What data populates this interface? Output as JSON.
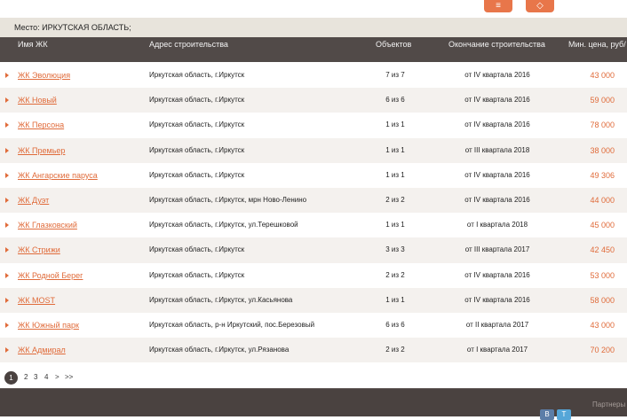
{
  "top_buttons": {
    "menu_icon": "≡",
    "pin_icon": "◇"
  },
  "location": "Место: ИРКУТСКАЯ ОБЛАСТЬ;",
  "columns": {
    "name": "Имя ЖК",
    "address": "Адрес строительства",
    "objects": "Объектов",
    "completion": "Окончание строительства",
    "min_price": "Мин. цена, руб/"
  },
  "rows": [
    {
      "name": "ЖК Эволюция",
      "address": "Иркутская область, г.Иркутск",
      "objects": "7 из 7",
      "completion": "от IV квартала 2016",
      "price": "43 000"
    },
    {
      "name": "ЖК Новый",
      "address": "Иркутская область, г.Иркутск",
      "objects": "6 из 6",
      "completion": "от IV квартала 2016",
      "price": "59 000"
    },
    {
      "name": "ЖК Персона",
      "address": "Иркутская область, г.Иркутск",
      "objects": "1 из 1",
      "completion": "от IV квартала 2016",
      "price": "78 000"
    },
    {
      "name": "ЖК Премьер",
      "address": "Иркутская область, г.Иркутск",
      "objects": "1 из 1",
      "completion": "от III квартала 2018",
      "price": "38 000"
    },
    {
      "name": "ЖК Ангарские паруса",
      "address": "Иркутская область, г.Иркутск",
      "objects": "1 из 1",
      "completion": "от IV квартала 2016",
      "price": "49 306"
    },
    {
      "name": "ЖК Дуэт",
      "address": "Иркутская область, г.Иркутск, мрн Ново-Ленино",
      "objects": "2 из 2",
      "completion": "от IV квартала 2016",
      "price": "44 000"
    },
    {
      "name": "ЖК Глазковский",
      "address": "Иркутская область, г.Иркутск, ул.Терешковой",
      "objects": "1 из 1",
      "completion": "от I квартала 2018",
      "price": "45 000"
    },
    {
      "name": "ЖК Стрижи",
      "address": "Иркутская область, г.Иркутск",
      "objects": "3 из 3",
      "completion": "от III квартала 2017",
      "price": "42 450"
    },
    {
      "name": "ЖК Родной Берег",
      "address": "Иркутская область, г.Иркутск",
      "objects": "2 из 2",
      "completion": "от IV квартала 2016",
      "price": "53 000"
    },
    {
      "name": "ЖК MOST",
      "address": "Иркутская область, г.Иркутск, ул.Касьянова",
      "objects": "1 из 1",
      "completion": "от IV квартала 2016",
      "price": "58 000"
    },
    {
      "name": "ЖК Южный парк",
      "address": "Иркутская область, р-н Иркутский, пос.Березовый",
      "objects": "6 из 6",
      "completion": "от II квартала 2017",
      "price": "43 000"
    },
    {
      "name": "ЖК Адмирал",
      "address": "Иркутская область, г.Иркутск, ул.Рязанова",
      "objects": "2 из 2",
      "completion": "от I квартала 2017",
      "price": "70 200"
    }
  ],
  "pagination": {
    "current": "1",
    "p2": "2",
    "p3": "3",
    "p4": "4",
    "next": ">",
    "last": ">>"
  },
  "footer": {
    "partners": "Партнеры",
    "vk": "В",
    "twitter": "T"
  }
}
